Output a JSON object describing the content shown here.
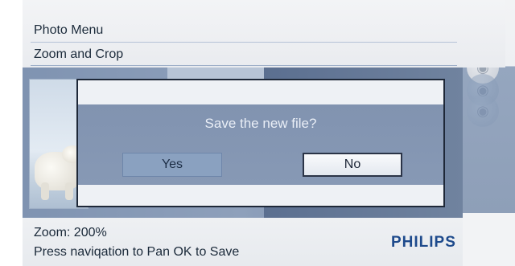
{
  "menu": {
    "title": "Photo Menu",
    "subtitle": "Zoom and Crop"
  },
  "dialog": {
    "prompt": "Save the new file?",
    "yes_label": "Yes",
    "no_label": "No",
    "selected": "No"
  },
  "status": {
    "zoom_text": "Zoom: 200%",
    "hint_text": "Press naviqation to Pan OK to Save"
  },
  "brand": {
    "name": "PHILIPS",
    "color": "#1e4a8c"
  },
  "icons": [
    "photo-icon",
    "slideshow-icon",
    "setup-icon",
    "settings-icon"
  ]
}
